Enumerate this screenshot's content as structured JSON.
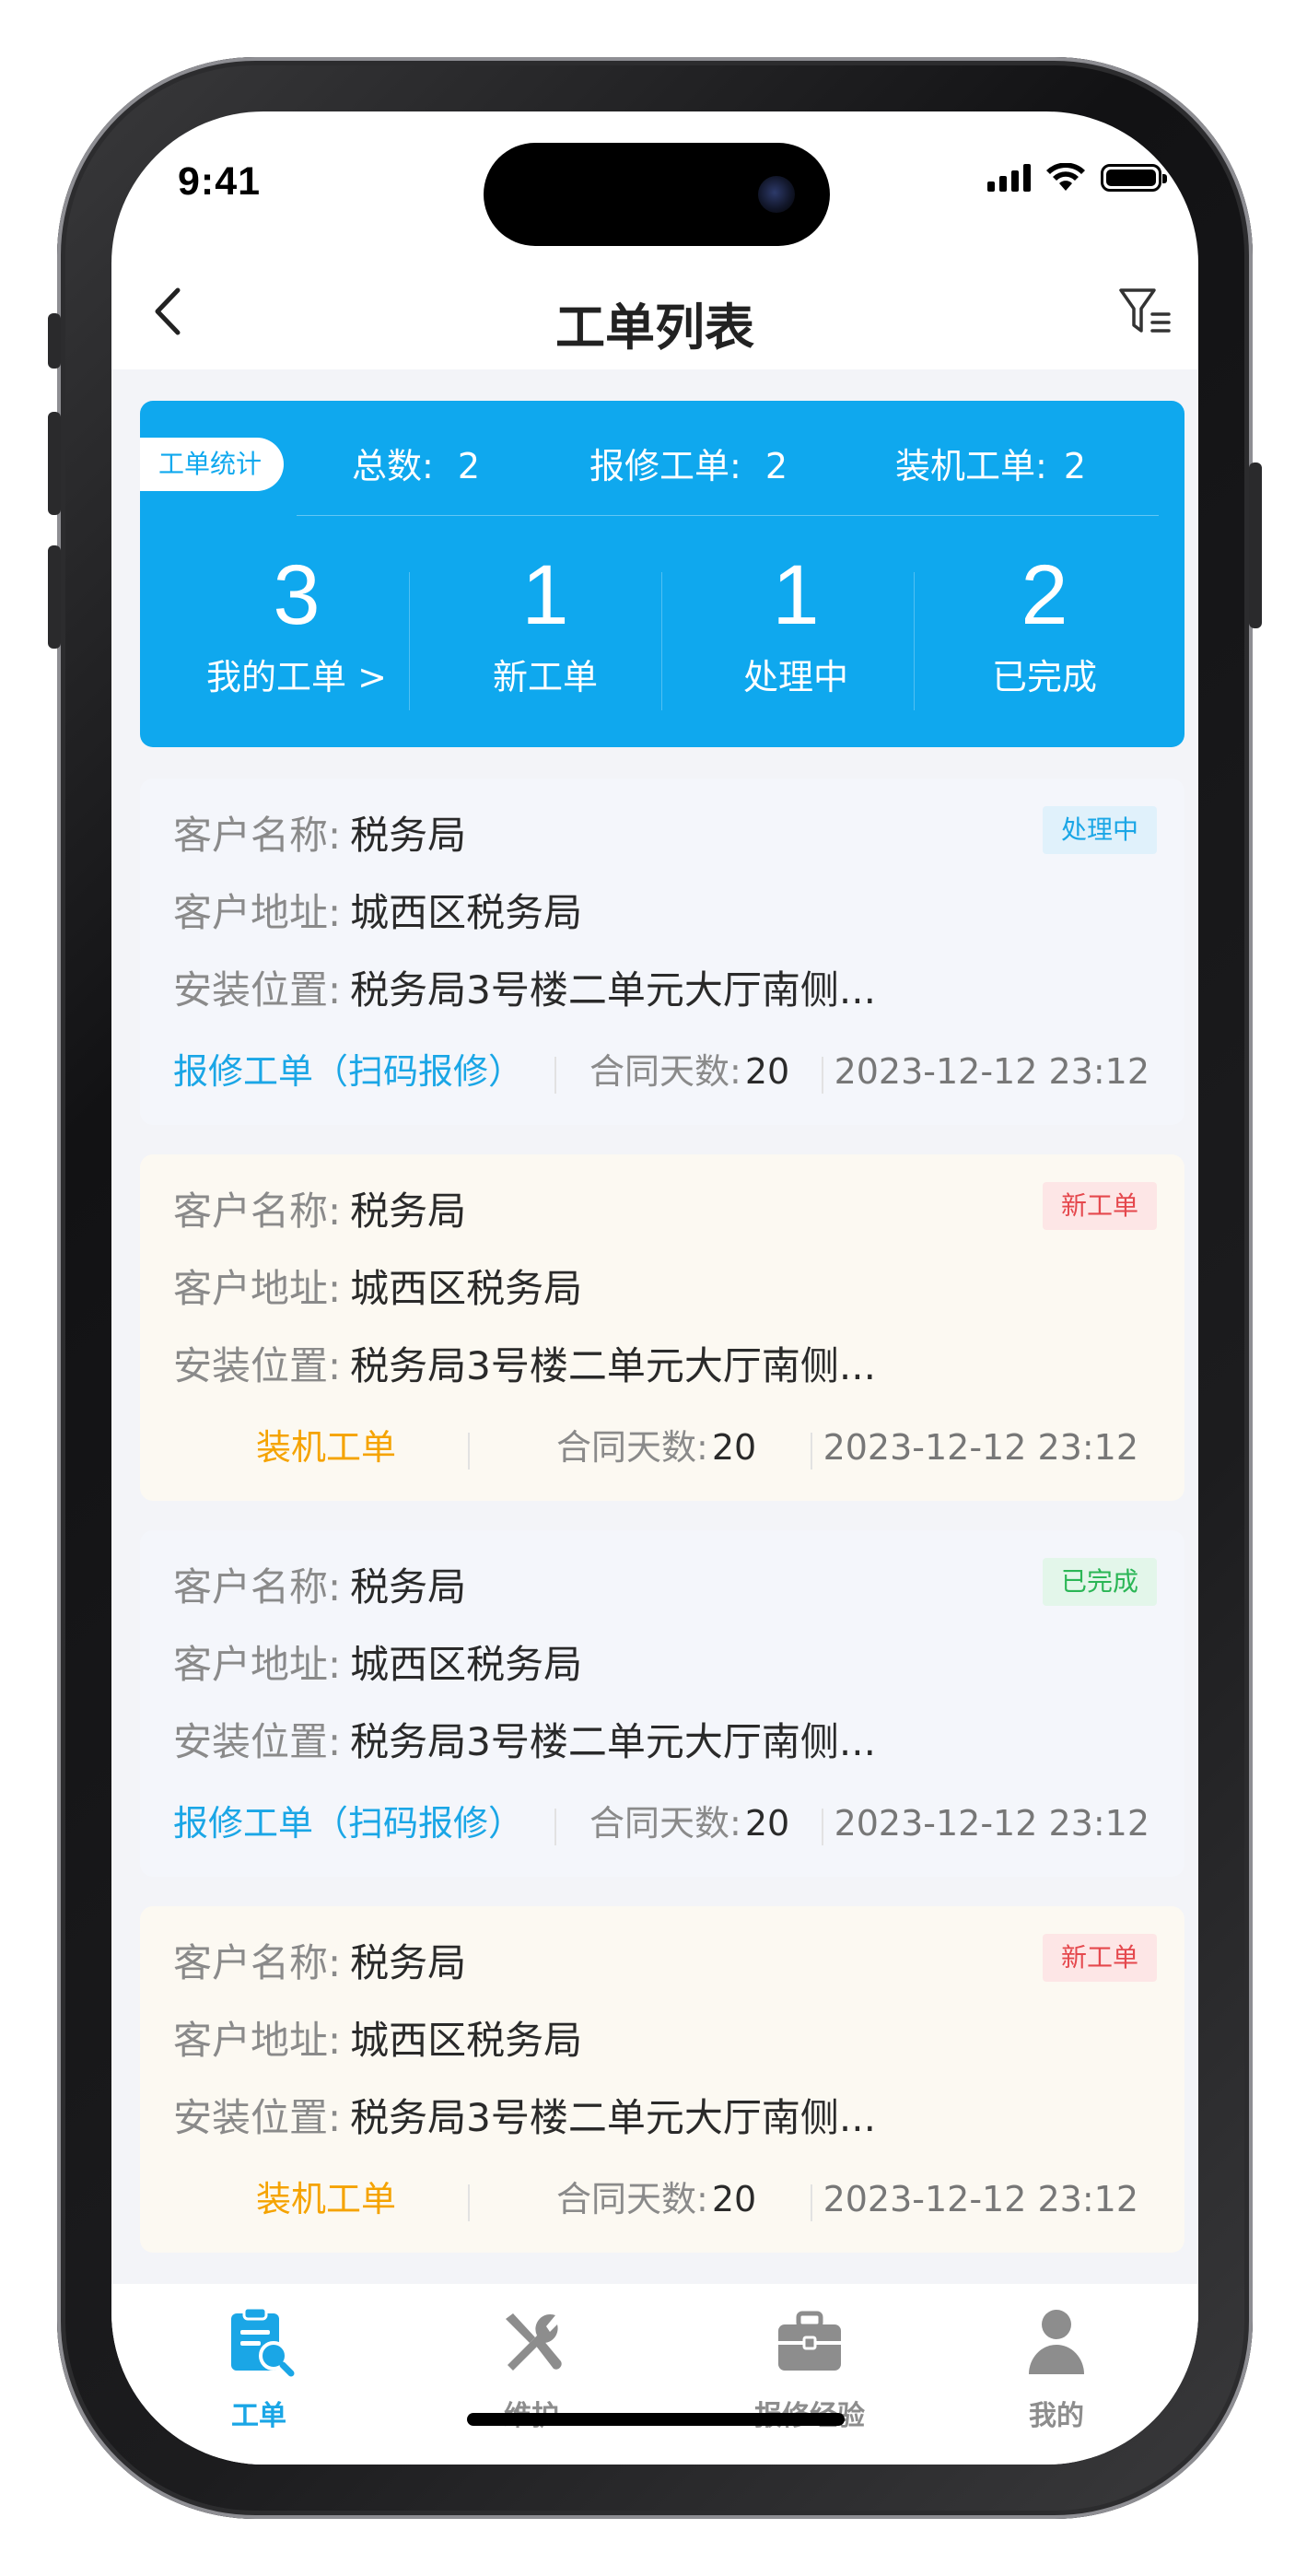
{
  "status_bar": {
    "time": "9:41"
  },
  "nav": {
    "title": "工单列表"
  },
  "stats": {
    "tag": "工单统计",
    "total_label": "总数:",
    "total_value": "2",
    "repair_label": "报修工单:",
    "repair_value": "2",
    "install_label": "装机工单:",
    "install_value": "2",
    "items": [
      {
        "value": "3",
        "label": "我的工单 >"
      },
      {
        "value": "1",
        "label": "新工单"
      },
      {
        "value": "1",
        "label": "处理中"
      },
      {
        "value": "2",
        "label": "已完成"
      }
    ]
  },
  "cards": [
    {
      "customer_name_label": "客户名称:",
      "customer_name": "税务局",
      "address_label": "客户地址:",
      "address": "城西区税务局",
      "location_label": "安装位置:",
      "location": "税务局3号楼二单元大厅南侧...",
      "status": "处理中",
      "type": "报修工单（扫码报修）",
      "days_label": "合同天数:",
      "days": "20",
      "date": "2023-12-12 23:12"
    },
    {
      "customer_name_label": "客户名称:",
      "customer_name": "税务局",
      "address_label": "客户地址:",
      "address": "城西区税务局",
      "location_label": "安装位置:",
      "location": "税务局3号楼二单元大厅南侧...",
      "status": "新工单",
      "type": "装机工单",
      "days_label": "合同天数:",
      "days": "20",
      "date": "2023-12-12 23:12"
    },
    {
      "customer_name_label": "客户名称:",
      "customer_name": "税务局",
      "address_label": "客户地址:",
      "address": "城西区税务局",
      "location_label": "安装位置:",
      "location": "税务局3号楼二单元大厅南侧...",
      "status": "已完成",
      "type": "报修工单（扫码报修）",
      "days_label": "合同天数:",
      "days": "20",
      "date": "2023-12-12 23:12"
    },
    {
      "customer_name_label": "客户名称:",
      "customer_name": "税务局",
      "address_label": "客户地址:",
      "address": "城西区税务局",
      "location_label": "安装位置:",
      "location": "税务局3号楼二单元大厅南侧...",
      "status": "新工单",
      "type": "装机工单",
      "days_label": "合同天数:",
      "days": "20",
      "date": "2023-12-12 23:12"
    }
  ],
  "tabbar": {
    "items": [
      {
        "label": "工单",
        "icon": "work-order-icon",
        "active": true
      },
      {
        "label": "维护",
        "icon": "wrench-screwdriver-icon",
        "active": false
      },
      {
        "label": "报修经验",
        "icon": "briefcase-icon",
        "active": false
      },
      {
        "label": "我的",
        "icon": "person-icon",
        "active": false
      }
    ]
  },
  "colors": {
    "accent": "#0fa8ee",
    "repair_type": "#1aa6e6",
    "install_type": "#f5a300",
    "status_new": "#e5484d",
    "status_done": "#2bb656"
  }
}
